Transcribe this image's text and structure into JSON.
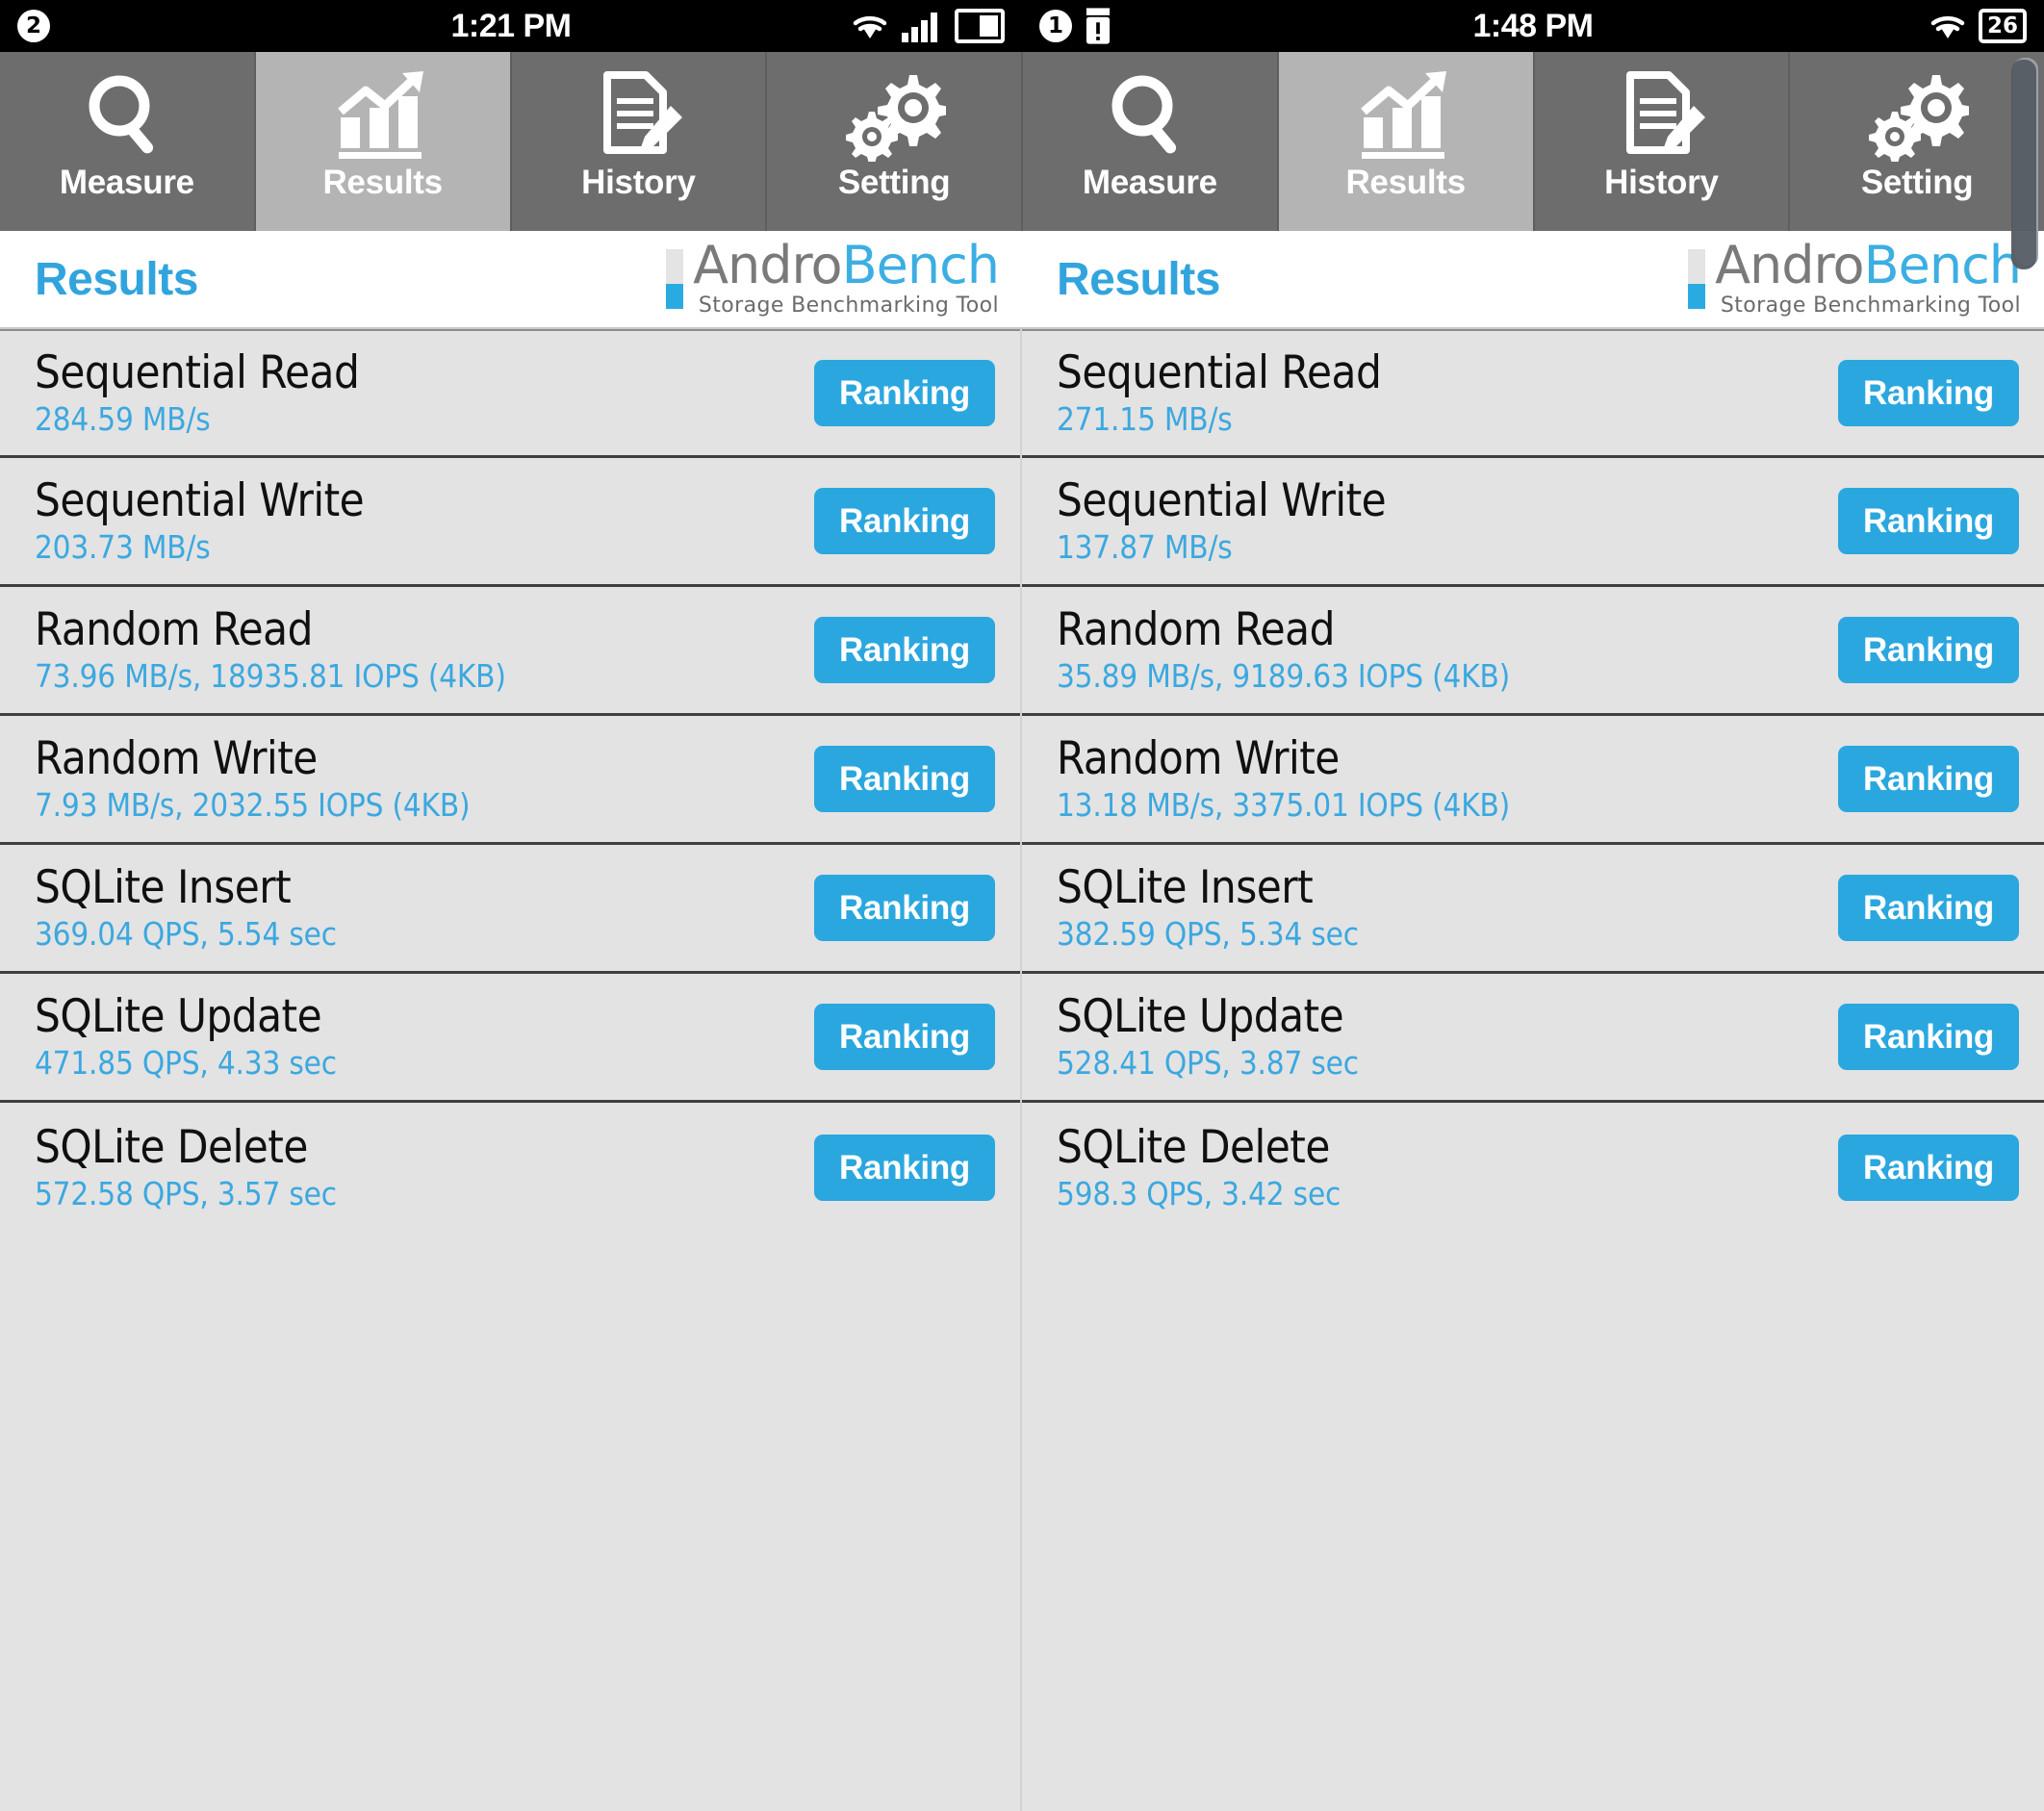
{
  "statusbars": [
    {
      "badge": "2",
      "time": "1:21 PM",
      "icons": [
        "wifi-icon",
        "signal-icon",
        "battery-icon"
      ],
      "battery": ""
    },
    {
      "badge": "1",
      "sd_icon": "sd-card-warning-icon",
      "time": "1:48 PM",
      "icons": [
        "wifi-icon",
        "battery-icon"
      ],
      "battery": "26"
    }
  ],
  "tabs": [
    {
      "label": "Measure",
      "icon": "magnifier-icon",
      "active": false
    },
    {
      "label": "Results",
      "icon": "bar-chart-icon",
      "active": true
    },
    {
      "label": "History",
      "icon": "document-pencil-icon",
      "active": false
    },
    {
      "label": "Setting",
      "icon": "gears-icon",
      "active": false
    },
    {
      "label": "Measure",
      "icon": "magnifier-icon",
      "active": false
    },
    {
      "label": "Results",
      "icon": "bar-chart-icon",
      "active": true
    },
    {
      "label": "History",
      "icon": "document-pencil-icon",
      "active": false
    },
    {
      "label": "Setting",
      "icon": "gears-icon",
      "active": false
    }
  ],
  "logo": {
    "part1": "Andro",
    "part2": "Bench",
    "tagline": "Storage Benchmarking Tool",
    "accent": "#3caee2",
    "gray": "#7a7a7a"
  },
  "page_title": "Results",
  "ranking_label": "Ranking",
  "colors": {
    "accent": "#2ba7e0",
    "value_text": "#3ba8e0",
    "row_bg": "#e3e3e3",
    "tab_bg": "#6d6d6d",
    "tab_active_bg": "#b4b4b4"
  },
  "panels": [
    {
      "rows": [
        {
          "title": "Sequential Read",
          "value": "284.59 MB/s"
        },
        {
          "title": "Sequential Write",
          "value": "203.73 MB/s"
        },
        {
          "title": "Random Read",
          "value": "73.96 MB/s, 18935.81 IOPS (4KB)"
        },
        {
          "title": "Random Write",
          "value": "7.93 MB/s, 2032.55 IOPS (4KB)"
        },
        {
          "title": "SQLite Insert",
          "value": "369.04 QPS, 5.54 sec"
        },
        {
          "title": "SQLite Update",
          "value": "471.85 QPS, 4.33 sec"
        },
        {
          "title": "SQLite Delete",
          "value": "572.58 QPS, 3.57 sec"
        }
      ]
    },
    {
      "rows": [
        {
          "title": "Sequential Read",
          "value": "271.15 MB/s"
        },
        {
          "title": "Sequential Write",
          "value": "137.87 MB/s"
        },
        {
          "title": "Random Read",
          "value": "35.89 MB/s, 9189.63 IOPS (4KB)"
        },
        {
          "title": "Random Write",
          "value": "13.18 MB/s, 3375.01 IOPS (4KB)"
        },
        {
          "title": "SQLite Insert",
          "value": "382.59 QPS, 5.34 sec"
        },
        {
          "title": "SQLite Update",
          "value": "528.41 QPS, 3.87 sec"
        },
        {
          "title": "SQLite Delete",
          "value": "598.3 QPS, 3.42 sec"
        }
      ]
    }
  ]
}
